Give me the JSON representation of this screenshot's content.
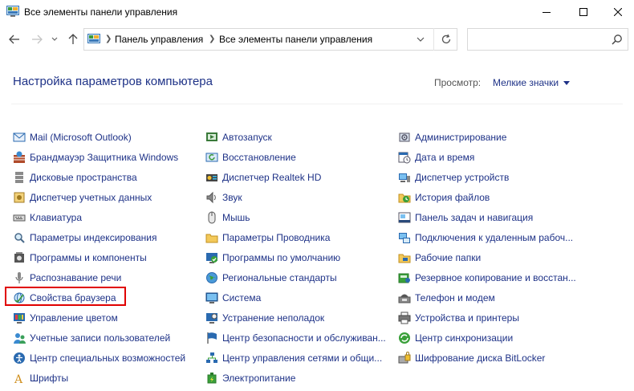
{
  "window": {
    "title": "Все элементы панели управления"
  },
  "address": {
    "crumbs": [
      "Панель управления",
      "Все элементы панели управления"
    ]
  },
  "search": {
    "placeholder": ""
  },
  "header": {
    "title": "Настройка параметров компьютера",
    "view_label": "Просмотр:",
    "view_value": "Мелкие значки"
  },
  "highlighted_item": "Свойства браузера",
  "columns": [
    {
      "items": [
        {
          "label": "Mail (Microsoft Outlook)",
          "icon": "mail-icon"
        },
        {
          "label": "Брандмауэр Защитника Windows",
          "icon": "firewall-icon"
        },
        {
          "label": "Дисковые пространства",
          "icon": "storage-spaces-icon"
        },
        {
          "label": "Диспетчер учетных данных",
          "icon": "credential-manager-icon"
        },
        {
          "label": "Клавиатура",
          "icon": "keyboard-icon"
        },
        {
          "label": "Параметры индексирования",
          "icon": "indexing-icon"
        },
        {
          "label": "Программы и компоненты",
          "icon": "programs-icon"
        },
        {
          "label": "Распознавание речи",
          "icon": "microphone-icon"
        },
        {
          "label": "Свойства браузера",
          "icon": "internet-options-icon"
        },
        {
          "label": "Управление цветом",
          "icon": "color-management-icon"
        },
        {
          "label": "Учетные записи пользователей",
          "icon": "user-accounts-icon"
        },
        {
          "label": "Центр специальных возможностей",
          "icon": "ease-of-access-icon"
        },
        {
          "label": "Шрифты",
          "icon": "fonts-icon"
        }
      ]
    },
    {
      "items": [
        {
          "label": "Автозапуск",
          "icon": "autoplay-icon"
        },
        {
          "label": "Восстановление",
          "icon": "recovery-icon"
        },
        {
          "label": "Диспетчер Realtek HD",
          "icon": "realtek-audio-icon"
        },
        {
          "label": "Звук",
          "icon": "speaker-icon"
        },
        {
          "label": "Мышь",
          "icon": "mouse-icon"
        },
        {
          "label": "Параметры Проводника",
          "icon": "folder-options-icon"
        },
        {
          "label": "Программы по умолчанию",
          "icon": "default-programs-icon"
        },
        {
          "label": "Региональные стандарты",
          "icon": "region-icon"
        },
        {
          "label": "Система",
          "icon": "system-icon"
        },
        {
          "label": "Устранение неполадок",
          "icon": "troubleshooting-icon"
        },
        {
          "label": "Центр безопасности и обслуживан...",
          "icon": "security-flag-icon"
        },
        {
          "label": "Центр управления сетями и общи...",
          "icon": "network-icon"
        },
        {
          "label": "Электропитание",
          "icon": "power-options-icon"
        }
      ]
    },
    {
      "items": [
        {
          "label": "Администрирование",
          "icon": "admin-tools-icon"
        },
        {
          "label": "Дата и время",
          "icon": "date-time-icon"
        },
        {
          "label": "Диспетчер устройств",
          "icon": "device-manager-icon"
        },
        {
          "label": "История файлов",
          "icon": "file-history-icon"
        },
        {
          "label": "Панель задач и навигация",
          "icon": "taskbar-icon"
        },
        {
          "label": "Подключения к удаленным рабоч...",
          "icon": "remote-desktop-icon"
        },
        {
          "label": "Рабочие папки",
          "icon": "work-folders-icon"
        },
        {
          "label": "Резервное копирование и восстан...",
          "icon": "backup-icon"
        },
        {
          "label": "Телефон и модем",
          "icon": "phone-modem-icon"
        },
        {
          "label": "Устройства и принтеры",
          "icon": "printer-icon"
        },
        {
          "label": "Центр синхронизации",
          "icon": "sync-center-icon"
        },
        {
          "label": "Шифрование диска BitLocker",
          "icon": "bitlocker-icon"
        }
      ]
    }
  ]
}
